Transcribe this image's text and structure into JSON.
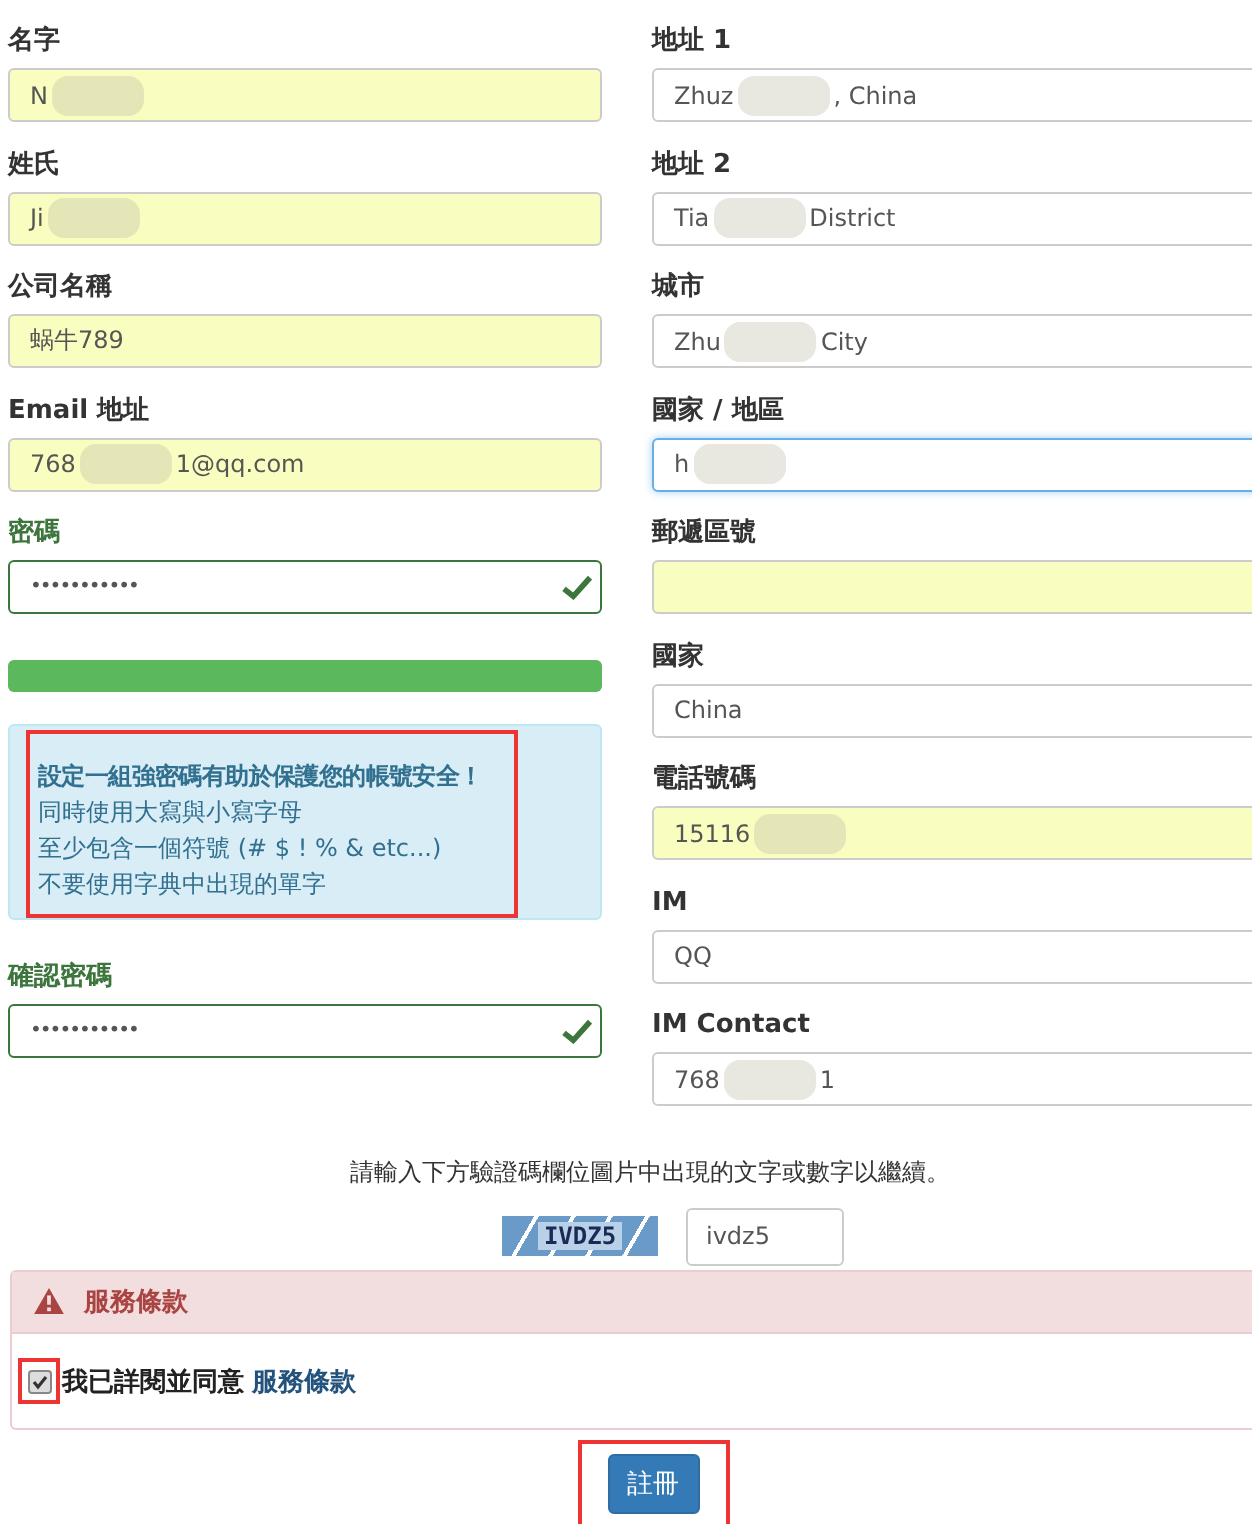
{
  "left_fields": [
    {
      "label": "名字",
      "kind": "text",
      "autofilled": true,
      "focused": false,
      "valid": false,
      "value": [
        {
          "text": "N"
        },
        {
          "kind": "redacted"
        }
      ]
    },
    {
      "label": "姓氏",
      "kind": "text",
      "autofilled": true,
      "focused": false,
      "valid": false,
      "value": [
        {
          "text": "Ji"
        },
        {
          "kind": "redacted"
        }
      ]
    },
    {
      "label": "公司名稱",
      "kind": "text",
      "autofilled": true,
      "focused": false,
      "valid": false,
      "value": [
        {
          "text": "蜗牛789"
        }
      ]
    },
    {
      "label": "Email 地址",
      "kind": "text",
      "autofilled": true,
      "focused": false,
      "valid": false,
      "value": [
        {
          "text": "768"
        },
        {
          "kind": "redacted"
        },
        {
          "text": "1@qq.com"
        }
      ]
    },
    {
      "label": "密碼",
      "kind": "password",
      "autofilled": false,
      "focused": false,
      "valid": true,
      "value": [
        {
          "text": "•••••••••••"
        }
      ]
    }
  ],
  "password_strength": {
    "level": 1.0
  },
  "password_hints": {
    "highlighted": true,
    "title": "設定一組強密碼有助於保護您的帳號安全！",
    "lines": [
      "同時使用大寫與小寫字母",
      "至少包含一個符號 (# $ ! % & etc...)",
      "不要使用字典中出現的單字"
    ]
  },
  "confirm_field": {
    "label": "確認密碼",
    "kind": "password",
    "autofilled": false,
    "focused": false,
    "valid": true,
    "value": [
      {
        "text": "•••••••••••"
      }
    ]
  },
  "right_fields": [
    {
      "label": "地址 1",
      "kind": "text",
      "autofilled": false,
      "focused": false,
      "valid": false,
      "value": [
        {
          "text": "Zhuz"
        },
        {
          "kind": "redacted"
        },
        {
          "text": ", China"
        }
      ]
    },
    {
      "label": "地址 2",
      "kind": "text",
      "autofilled": false,
      "focused": false,
      "valid": false,
      "value": [
        {
          "text": "Tia"
        },
        {
          "kind": "redacted"
        },
        {
          "text": "District"
        }
      ]
    },
    {
      "label": "城市",
      "kind": "text",
      "autofilled": false,
      "focused": false,
      "valid": false,
      "value": [
        {
          "text": "Zhu"
        },
        {
          "kind": "redacted"
        },
        {
          "text": "City"
        }
      ]
    },
    {
      "label": "國家 / 地區",
      "kind": "text",
      "autofilled": false,
      "focused": true,
      "valid": false,
      "value": [
        {
          "text": "h"
        },
        {
          "kind": "redacted"
        }
      ]
    },
    {
      "label": "郵遞區號",
      "kind": "text",
      "autofilled": true,
      "focused": false,
      "valid": false
    },
    {
      "label": "國家",
      "kind": "text",
      "autofilled": false,
      "focused": false,
      "valid": false,
      "value": [
        {
          "text": "China"
        }
      ]
    },
    {
      "label": "電話號碼",
      "kind": "text",
      "autofilled": true,
      "focused": false,
      "valid": false,
      "value": [
        {
          "text": "15116"
        },
        {
          "kind": "redacted"
        }
      ]
    },
    {
      "label": "IM",
      "kind": "text",
      "autofilled": false,
      "focused": false,
      "valid": false,
      "value": [
        {
          "text": "QQ"
        }
      ]
    },
    {
      "label": "IM Contact",
      "kind": "text",
      "autofilled": false,
      "focused": false,
      "valid": false,
      "value": [
        {
          "text": "768"
        },
        {
          "kind": "redacted"
        },
        {
          "text": "1"
        }
      ]
    }
  ],
  "captcha": {
    "instruction": "請輸入下方驗證碼欄位圖片中出現的文字或數字以繼續。",
    "image_text": "IVDZ5",
    "value": "ivdz5"
  },
  "terms": {
    "title": "服務條款",
    "agree_text": "我已詳閱並同意",
    "link": "服務條款",
    "checked": true,
    "highlighted": true
  },
  "submit": {
    "label": "註冊",
    "highlighted": true
  }
}
